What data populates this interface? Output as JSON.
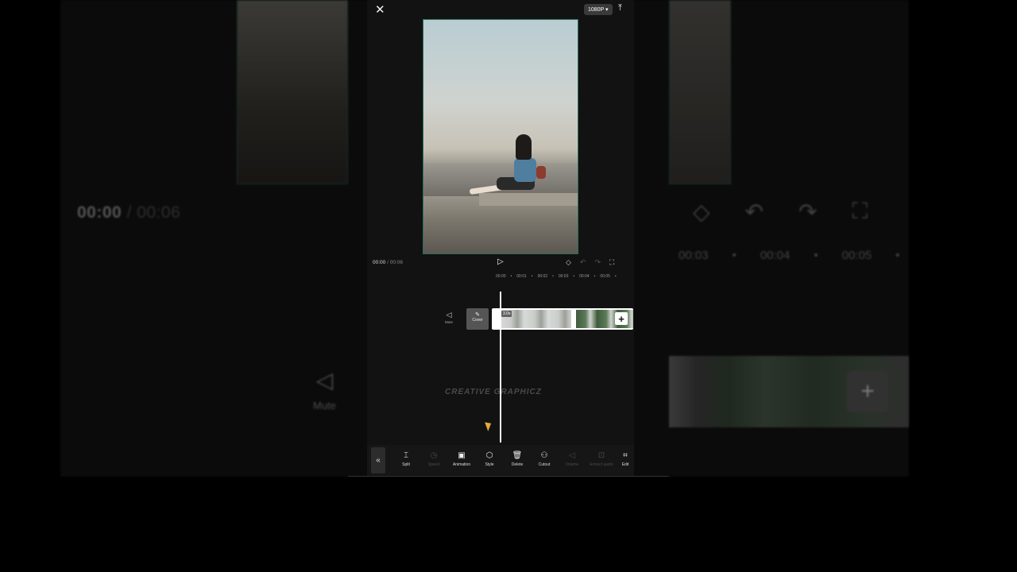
{
  "backdrop": {
    "time_current": "00:00",
    "time_total": "/ 00:06",
    "ticks": [
      "00:03",
      "•",
      "00:04",
      "•",
      "00:05",
      "•"
    ],
    "mute_label": "Mute",
    "plus": "+"
  },
  "topbar": {
    "close_glyph": "✕",
    "resolution": "1080P ▾",
    "export_glyph": "⤒"
  },
  "player": {
    "time_current": "00:00",
    "time_total": "/ 00:06",
    "play_glyph": "▷"
  },
  "ruler": [
    "00:00",
    "•",
    "00:01",
    "•",
    "00:02",
    "•",
    "00:03",
    "•",
    "00:04",
    "•",
    "00:05",
    "•"
  ],
  "track": {
    "mute_label": "Mute",
    "cover_label": "Cover",
    "clip_duration": "3.0s",
    "add_glyph": "+"
  },
  "watermark": "CREATIVE GRAPHICZ",
  "toolbar": {
    "collapse_glyph": "«",
    "tools": [
      {
        "label": "Split",
        "glyph": "⌶"
      },
      {
        "label": "Speed",
        "glyph": "◷"
      },
      {
        "label": "Animation",
        "glyph": "▣"
      },
      {
        "label": "Style",
        "glyph": "⬡"
      },
      {
        "label": "Delete",
        "glyph": "🗑"
      },
      {
        "label": "Cutout",
        "glyph": "⚇"
      },
      {
        "label": "Volume",
        "glyph": "◁"
      },
      {
        "label": "Extract audio",
        "glyph": "⊡"
      },
      {
        "label": "Edit",
        "glyph": "⌗"
      }
    ]
  },
  "colors": {
    "accent_border": "#2e6e5a",
    "background": "#121212",
    "cursor": "#e6a93a"
  }
}
